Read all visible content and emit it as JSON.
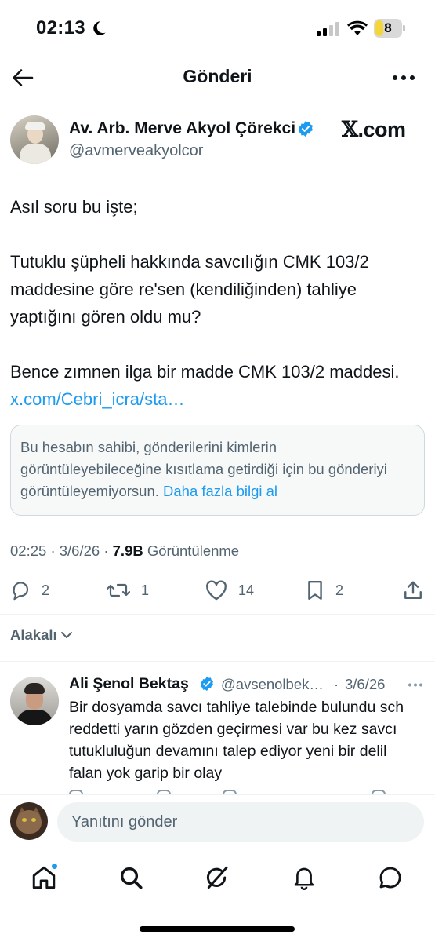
{
  "status_bar": {
    "time": "02:13",
    "battery": "8"
  },
  "header": {
    "title": "Gönderi"
  },
  "post": {
    "author_name": "Av. Arb. Merve Akyol Çörekci",
    "author_handle": "@avmerveakyolcor",
    "watermark_x": "𝕏",
    "watermark_suffix": ".com",
    "paragraph_1": "Asıl soru bu işte;",
    "paragraph_2": "Tutuklu şüpheli hakkında savcılığın CMK 103/2 maddesine göre re'sen (kendiliğinden) tahliye yaptığını gören oldu mu?",
    "paragraph_3": "Bence zımnen ilga bir madde CMK 103/2 maddesi.",
    "link": "x.com/Cebri_icra/sta…",
    "restricted_notice": "Bu hesabın sahibi, gönderilerini kimlerin görüntüleyebileceğine kısıtlama getirdiği için bu gönderiyi görüntüleyemiyorsun.",
    "restricted_link": "Daha fazla bilgi al",
    "time": "02:25",
    "date": "3/6/26",
    "separator": "·",
    "views_count": "7.9B",
    "views_label": "Görüntülenme",
    "counts": {
      "replies": "2",
      "reposts": "1",
      "likes": "14",
      "bookmarks": "2"
    }
  },
  "sort": {
    "label": "Alakalı"
  },
  "reply": {
    "author_name": "Ali Şenol Bektaş",
    "author_handle": "@avsenolbek…",
    "separator": "·",
    "date": "3/6/26",
    "text": "Bir dosyamda savcı tahliye talebinde bulundu sch reddetti yarın gözden geçirmesi var bu kez savcı tutukluluğun devamını talep ediyor yeni bir delil falan yok garip bir olay"
  },
  "compose": {
    "placeholder": "Yanıtını gönder"
  },
  "icons": {
    "back": "arrow-left-icon",
    "more": "more-horizontal-icon",
    "verified": "verified-badge-icon",
    "reply": "reply-icon",
    "repost": "repost-icon",
    "like": "heart-icon",
    "bookmark": "bookmark-icon",
    "share": "share-icon",
    "home": "home-icon",
    "search": "search-icon",
    "grok": "grok-icon",
    "notifications": "bell-icon",
    "messages": "messages-icon"
  },
  "colors": {
    "accent": "#1d9bf0",
    "text": "#0f1419",
    "secondary": "#536471",
    "battery": "#f4d53a"
  }
}
